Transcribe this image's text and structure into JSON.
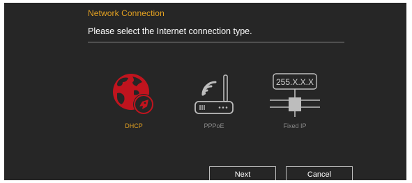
{
  "section": {
    "title": "Network Connection",
    "prompt": "Please select the Internet connection type."
  },
  "options": [
    {
      "label": "DHCP",
      "icon": "globe-rocket-icon",
      "selected": true
    },
    {
      "label": "PPPoE",
      "icon": "router-wifi-icon",
      "selected": false
    },
    {
      "label": "Fixed IP",
      "icon": "ip-address-network-icon",
      "selected": false,
      "icon_text": "255.X.X.X"
    }
  ],
  "buttons": {
    "next_label": "Next",
    "cancel_label": "Cancel"
  },
  "colors": {
    "background": "#262626",
    "accent_gold": "#e2a021",
    "accent_red": "#c0141e",
    "inactive_icon": "#bdbdbd",
    "inactive_label": "#8a8a8a"
  }
}
